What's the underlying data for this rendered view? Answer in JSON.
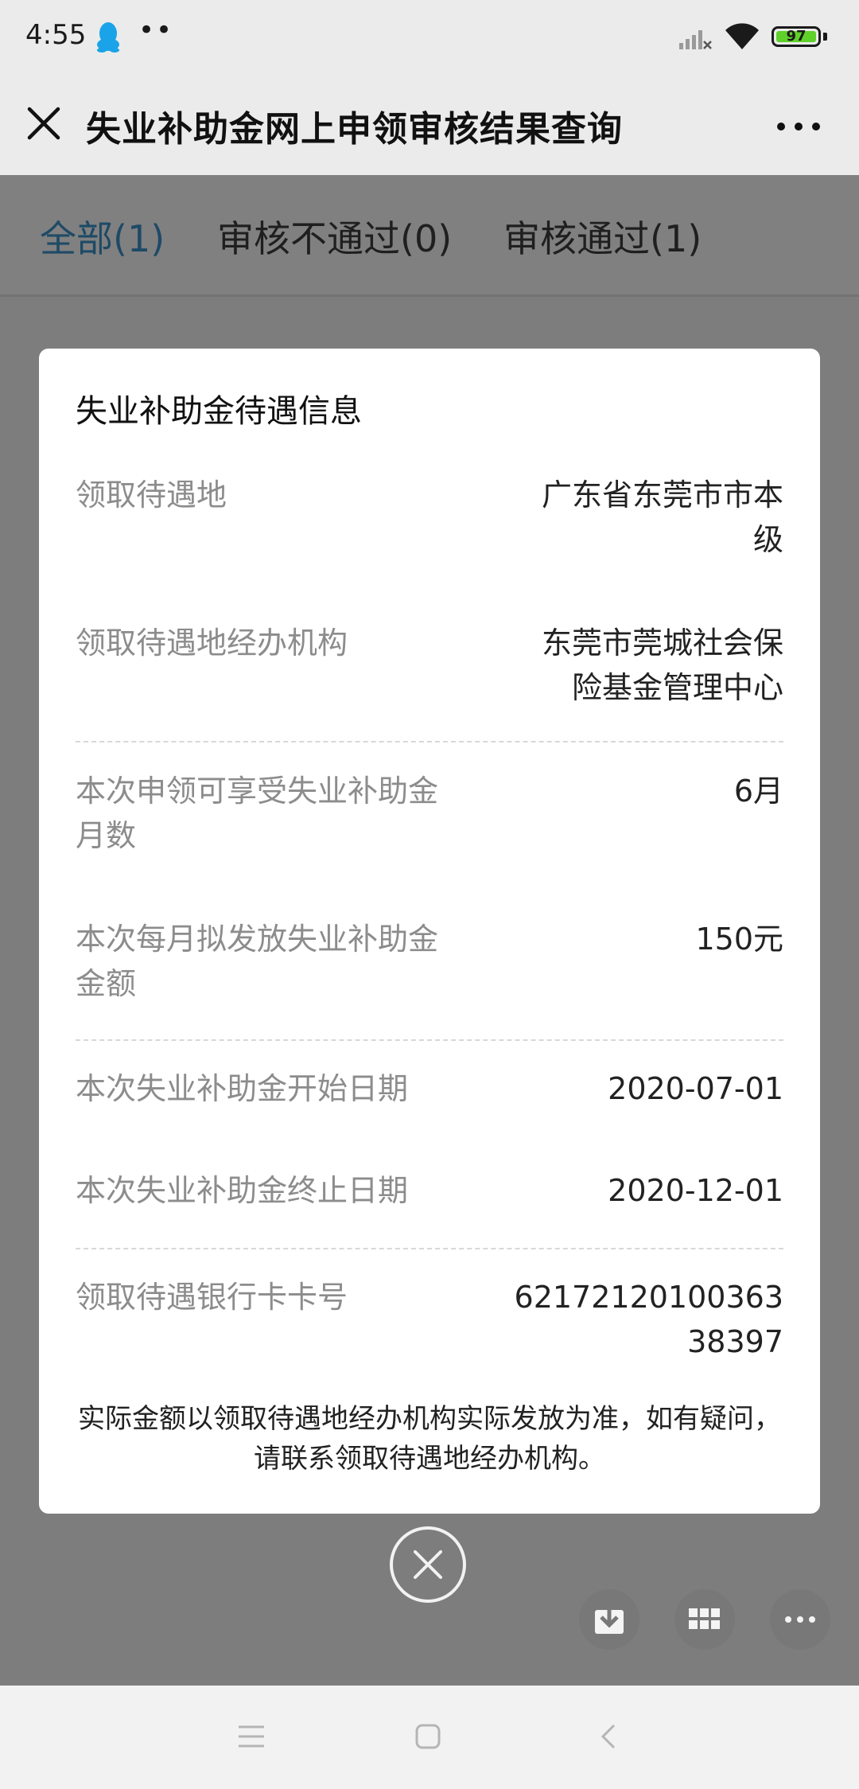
{
  "status_bar": {
    "time": "4:55",
    "notification_icons": [
      "qq-penguin-icon",
      "more-notifications-dots"
    ],
    "dots": "••",
    "battery": "97"
  },
  "header": {
    "title": "失业补助金网上申领审核结果查询"
  },
  "tabs": [
    {
      "label": "全部(1)",
      "active": true
    },
    {
      "label": "审核不通过(0)",
      "active": false
    },
    {
      "label": "审核通过(1)",
      "active": false
    }
  ],
  "dialog": {
    "title": "失业补助金待遇信息",
    "rows": [
      {
        "label": "领取待遇地",
        "value_line1": "广东省东莞市市本",
        "value_line2": "级"
      },
      {
        "label": "领取待遇地经办机构",
        "value_line1": "东莞市莞城社会保",
        "value_line2": "险基金管理中心"
      },
      {
        "label_line1": "本次申领可享受失业补助金",
        "label_line2": "月数",
        "value": "6月"
      },
      {
        "label_line1": "本次每月拟发放失业补助金",
        "label_line2": "金额",
        "value": "150元"
      },
      {
        "label": "本次失业补助金开始日期",
        "value": "2020-07-01"
      },
      {
        "label": "本次失业补助金终止日期",
        "value": "2020-12-01"
      },
      {
        "label": "领取待遇银行卡卡号",
        "value_line1": "62172120100363",
        "value_line2": "38397"
      }
    ],
    "note_line1": "实际金额以领取待遇地经办机构实际发放为准，如有疑问，",
    "note_line2": "请联系领取待遇地经办机构。"
  },
  "colors": {
    "overlay": "#7d7d7d",
    "active_tab": "#1e4a66",
    "battery_fill": "#5fd12a"
  }
}
